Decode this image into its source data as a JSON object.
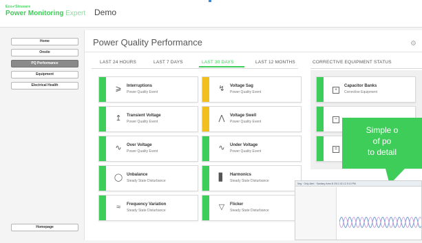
{
  "header": {
    "brand_top": "Eco✔Struxure",
    "brand_name": "Power Monitoring",
    "brand_suffix": "Expert",
    "app_title": "Demo"
  },
  "sidebar": {
    "items": [
      {
        "label": "Home",
        "active": false
      },
      {
        "label": "Onsite",
        "active": false
      },
      {
        "label": "PQ Performance",
        "active": true
      },
      {
        "label": "Equipment",
        "active": false
      },
      {
        "label": "Electrical Health",
        "active": false
      }
    ],
    "bottom_item": "Homepage"
  },
  "panel": {
    "title": "Power Quality Performance",
    "tabs": [
      "LAST 24 HOURS",
      "LAST 7 DAYS",
      "LAST 30 DAYS",
      "LAST 12 MONTHS"
    ],
    "active_tab": "LAST 30 DAYS",
    "corrective_title": "CORRECTIVE EQUIPMENT STATUS"
  },
  "cards": [
    {
      "title": "Interruptions",
      "subtitle": "Power Quality Event",
      "icon": "interruption-icon",
      "status_color": "#3dcd58"
    },
    {
      "title": "Voltage Sag",
      "subtitle": "Power Quality Event",
      "icon": "voltage-sag-icon",
      "status_color": "#f2c01e"
    },
    {
      "title": "Transient Voltage",
      "subtitle": "Power Quality Event",
      "icon": "transient-icon",
      "status_color": "#3dcd58"
    },
    {
      "title": "Voltage Swell",
      "subtitle": "Power Quality Event",
      "icon": "voltage-swell-icon",
      "status_color": "#f2c01e"
    },
    {
      "title": "Over Voltage",
      "subtitle": "Power Quality Event",
      "icon": "over-voltage-icon",
      "status_color": "#3dcd58"
    },
    {
      "title": "Under Voltage",
      "subtitle": "Power Quality Event",
      "icon": "under-voltage-icon",
      "status_color": "#3dcd58"
    },
    {
      "title": "Unbalance",
      "subtitle": "Steady State Disturbance",
      "icon": "unbalance-icon",
      "status_color": "#3dcd58"
    },
    {
      "title": "Harmonics",
      "subtitle": "Steady State Disturbance",
      "icon": "harmonics-icon",
      "status_color": "#3dcd58"
    },
    {
      "title": "Frequency Variation",
      "subtitle": "Steady State Disturbance",
      "icon": "frequency-icon",
      "status_color": "#3dcd58"
    },
    {
      "title": "Flicker",
      "subtitle": "Steady State Disturbance",
      "icon": "flicker-icon",
      "status_color": "#3dcd58"
    }
  ],
  "corrective_cards": [
    {
      "title": "Capacitor Banks",
      "subtitle": "Corrective Equipment",
      "icon": "capacitor-icon",
      "status_color": "#3dcd58"
    },
    {
      "title": "",
      "subtitle": "",
      "icon": "filter-icon",
      "status_color": "#3dcd58"
    },
    {
      "title": "",
      "subtitle": "",
      "icon": "ups-icon",
      "status_color": "#3dcd58"
    }
  ],
  "callout": {
    "line1": "Simple o",
    "line2": "of po",
    "line3": "to detail"
  },
  "mini_screenshot": {
    "header_text": "Seg · Only Alert · Sanitary Area B 2012-02-12 5:13 PM"
  },
  "colors": {
    "accent": "#3dcd58",
    "warning": "#f2c01e"
  }
}
